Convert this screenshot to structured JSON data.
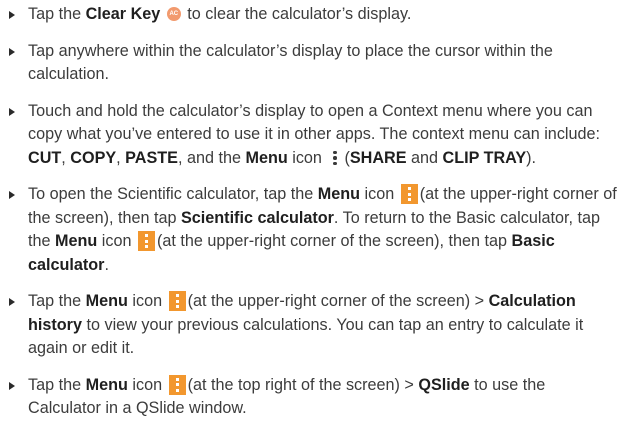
{
  "items": [
    {
      "t0": "Tap the ",
      "b0": "Clear Key",
      "t1": " to clear the calculator’s display."
    },
    {
      "t0": "Tap anywhere within the calculator’s display to place the cursor within the calculation."
    },
    {
      "t0": "Touch and hold the calculator’s display to open a Context menu where you can copy what you’ve entered to use it in other apps. The context menu can include: ",
      "b0": "CUT",
      "t1": ", ",
      "b1": "COPY",
      "t2": ", ",
      "b2": "PASTE",
      "t3": ", and the ",
      "b3": "Menu",
      "t4": " icon ",
      "t5": "(",
      "b4": "SHARE",
      "t6": " and ",
      "b5": "CLIP TRAY",
      "t7": ")."
    },
    {
      "t0": "To open the Scientific calculator, tap the ",
      "b0": "Menu",
      "t1": " icon ",
      "t2": "(at the upper-right corner of the screen), then tap ",
      "b1": "Scientific calculator",
      "t3": ". To return to the Basic calculator, tap the ",
      "b2": "Menu",
      "t4": " icon ",
      "t5": "(at the upper-right corner of the screen), then tap ",
      "b3": "Basic calculator",
      "t6": "."
    },
    {
      "t0": "Tap the ",
      "b0": "Menu",
      "t1": " icon ",
      "t2": "(at the upper-right corner of the screen) > ",
      "b1": "Calculation history",
      "t3": " to view your previous calculations. You can tap an entry to calculate it again or edit it."
    },
    {
      "t0": "Tap the ",
      "b0": "Menu",
      "t1": " icon ",
      "t2": "(at the top right of the screen) > ",
      "b1": "QSlide",
      "t3": " to use the Calculator in a QSlide window."
    }
  ],
  "icons": {
    "clear_key": "clear-key-icon",
    "menu": "menu-icon"
  },
  "colors": {
    "clear_key": "#f29a6e",
    "menu_box": "#f2972e"
  }
}
